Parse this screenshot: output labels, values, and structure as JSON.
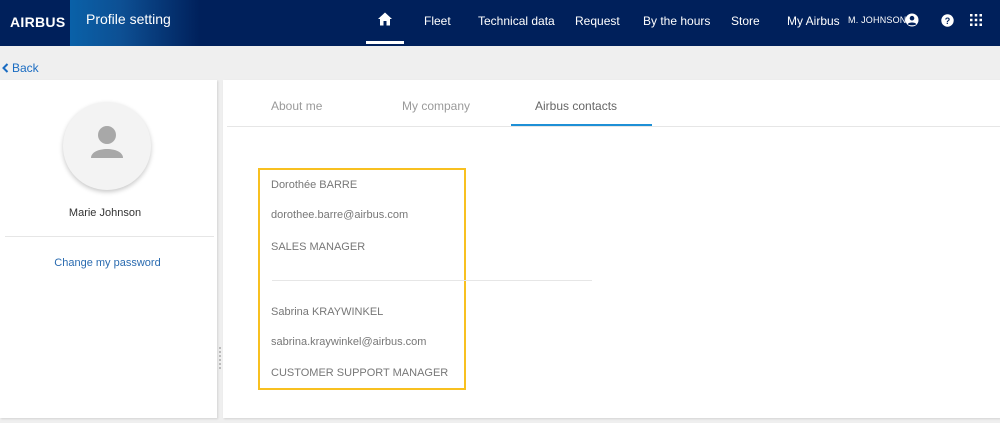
{
  "header": {
    "logo": "AIRBUS",
    "app_title": "Profile setting",
    "nav": {
      "home_icon": "home-icon",
      "items": [
        "Fleet",
        "Technical data",
        "Request",
        "By the hours",
        "Store",
        "My Airbus"
      ]
    },
    "user_name": "M. JOHNSON",
    "user_icon": "user-circle-icon",
    "help_icon": "help-icon",
    "apps_icon": "apps-grid-icon"
  },
  "back": {
    "label": "Back"
  },
  "profile": {
    "name": "Marie Johnson",
    "change_password": "Change my password"
  },
  "tabs": {
    "items": [
      "About me",
      "My company",
      "Airbus contacts"
    ],
    "active": "Airbus contacts"
  },
  "contacts": [
    {
      "name": "Dorothée BARRE",
      "email": "dorothee.barre@airbus.com",
      "role": "SALES MANAGER"
    },
    {
      "name": "Sabrina KRAYWINKEL",
      "email": "sabrina.kraywinkel@airbus.com",
      "role": "CUSTOMER SUPPORT MANAGER"
    }
  ],
  "colors": {
    "header_bg": "#00205b",
    "link": "#1a6cc2",
    "highlight_border": "#f8c020",
    "tab_underline": "#1e90d6"
  }
}
